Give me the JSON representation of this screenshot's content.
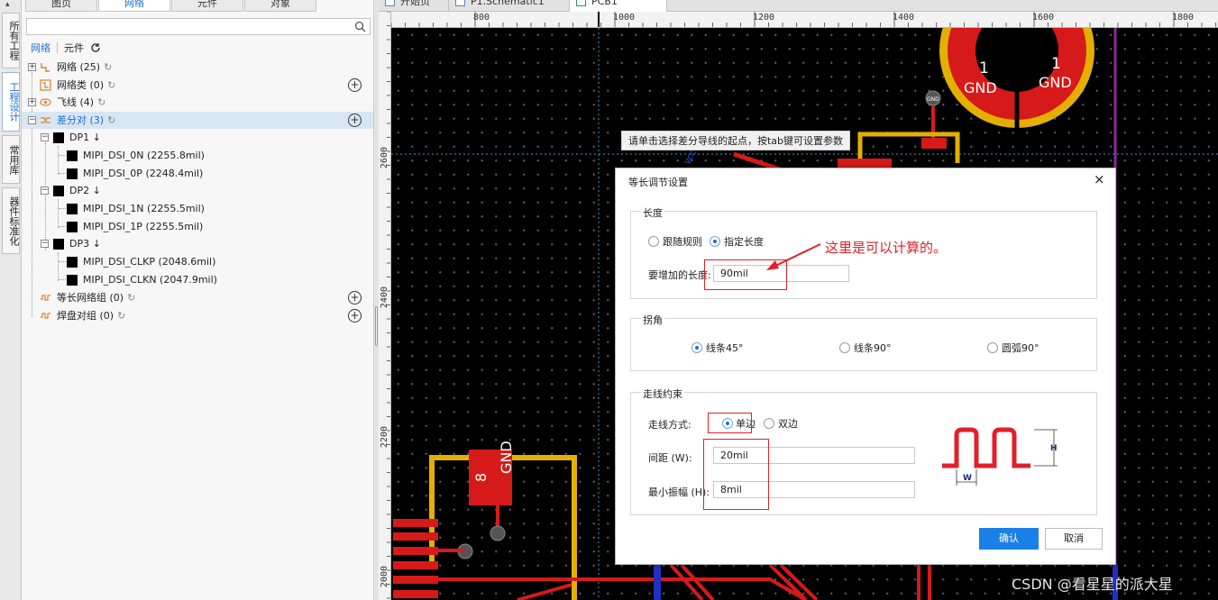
{
  "left_tabs": [
    "所有工程",
    "工程设计",
    "常用库",
    "器件标准化"
  ],
  "panel_tabs": [
    "图页",
    "网络",
    "元件",
    "对象"
  ],
  "search": {
    "value": "",
    "placeholder": ""
  },
  "subtabs": {
    "net": "网络",
    "component": "元件"
  },
  "tree": {
    "nets": {
      "label": "网络",
      "count": "(25)"
    },
    "netclass": {
      "label": "网络类",
      "count": "(0)"
    },
    "flylines": {
      "label": "飞线",
      "count": "(4)"
    },
    "diffpairs": {
      "label": "差分对",
      "count": "(3)"
    },
    "dp1": {
      "label": "DP1 ↓",
      "n": "MIPI_DSI_0N (2255.8mil)",
      "p": "MIPI_DSI_0P (2248.4mil)"
    },
    "dp2": {
      "label": "DP2 ↓",
      "n": "MIPI_DSI_1N (2255.5mil)",
      "p": "MIPI_DSI_1P (2255.5mil)"
    },
    "dp3": {
      "label": "DP3 ↓",
      "n": "MIPI_DSI_CLKP (2048.6mil)",
      "p": "MIPI_DSI_CLKN (2047.9mil)"
    },
    "eqlen": {
      "label": "等长网络组",
      "count": "(0)"
    },
    "padpair": {
      "label": "焊盘对组",
      "count": "(0)"
    }
  },
  "doc_tabs": [
    "开始页",
    "P1.Schematic1",
    "PCB1"
  ],
  "ruler": {
    "h_labels": [
      "800",
      "1000",
      "1200",
      "1400",
      "1600",
      "1800"
    ],
    "v_labels": [
      "2600",
      "2400",
      "2200",
      "2000"
    ]
  },
  "pcb": {
    "pad_labels": [
      "1",
      "GND",
      "1",
      "GND",
      "8",
      "GND"
    ],
    "tag": "GND"
  },
  "hint": "请单击选择差分导线的起点，按tab键可设置参数",
  "dialog": {
    "title": "等长调节设置",
    "close": "×",
    "length": {
      "group": "长度",
      "opt_follow": "跟随规则",
      "opt_specify": "指定长度",
      "add_label": "要增加的长度:",
      "add_value": "90mil"
    },
    "corner": {
      "group": "拐角",
      "opt1": "线条45°",
      "opt2": "线条90°",
      "opt3": "圆弧90°"
    },
    "routing": {
      "group": "走线约束",
      "mode_label": "走线方式:",
      "mode_single": "单边",
      "mode_double": "双边",
      "spacing_label": "间距 (W):",
      "spacing_value": "20mil",
      "amp_label": "最小振幅 (H):",
      "amp_value": "8mil",
      "diagram_h": "H",
      "diagram_w": "W"
    },
    "ok": "确认",
    "cancel": "取消"
  },
  "annotation": "这里是可以计算的。",
  "watermark": "CSDN @看星星的派大星",
  "colors": {
    "accent": "#1a6fd1",
    "annotation": "#e0202a",
    "trace_red": "#e0202a",
    "trace_yellow": "#e3b000"
  }
}
